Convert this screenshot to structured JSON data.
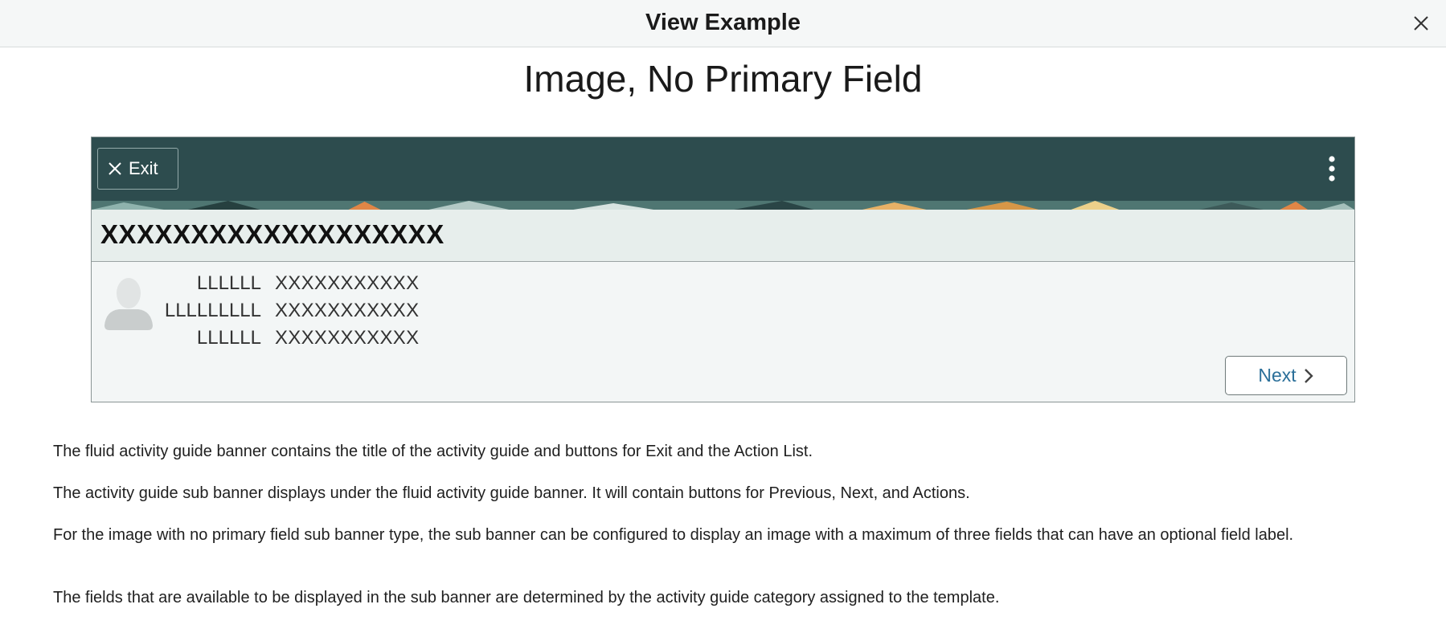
{
  "modal": {
    "title": "View Example",
    "close_icon": "close-icon"
  },
  "page_title": "Image, No Primary Field",
  "example": {
    "exit_label": "Exit",
    "actions_icon": "vertical-ellipsis-icon",
    "guide_title": "XXXXXXXXXXXXXXXXXXX",
    "fields": [
      {
        "label": "LLLLLL",
        "value": "XXXXXXXXXXX"
      },
      {
        "label": "LLLLLLLLL",
        "value": "XXXXXXXXXXX"
      },
      {
        "label": "LLLLLL",
        "value": "XXXXXXXXXXX"
      }
    ],
    "next_label": "Next",
    "colors": {
      "banner": "#2d4c4e",
      "link": "#2b6f99"
    }
  },
  "descriptions": [
    "The fluid activity guide banner contains the title of the activity guide and buttons for Exit and the Action List.",
    "The activity guide sub banner displays under the fluid activity guide banner.  It will contain buttons for Previous, Next, and Actions.",
    "For the image with no primary field sub banner type, the sub banner can be configured to display an image with a maximum of three fields that can have an optional field label.",
    "The fields that are available to be displayed in the sub banner are determined by the activity guide category assigned to the template."
  ]
}
